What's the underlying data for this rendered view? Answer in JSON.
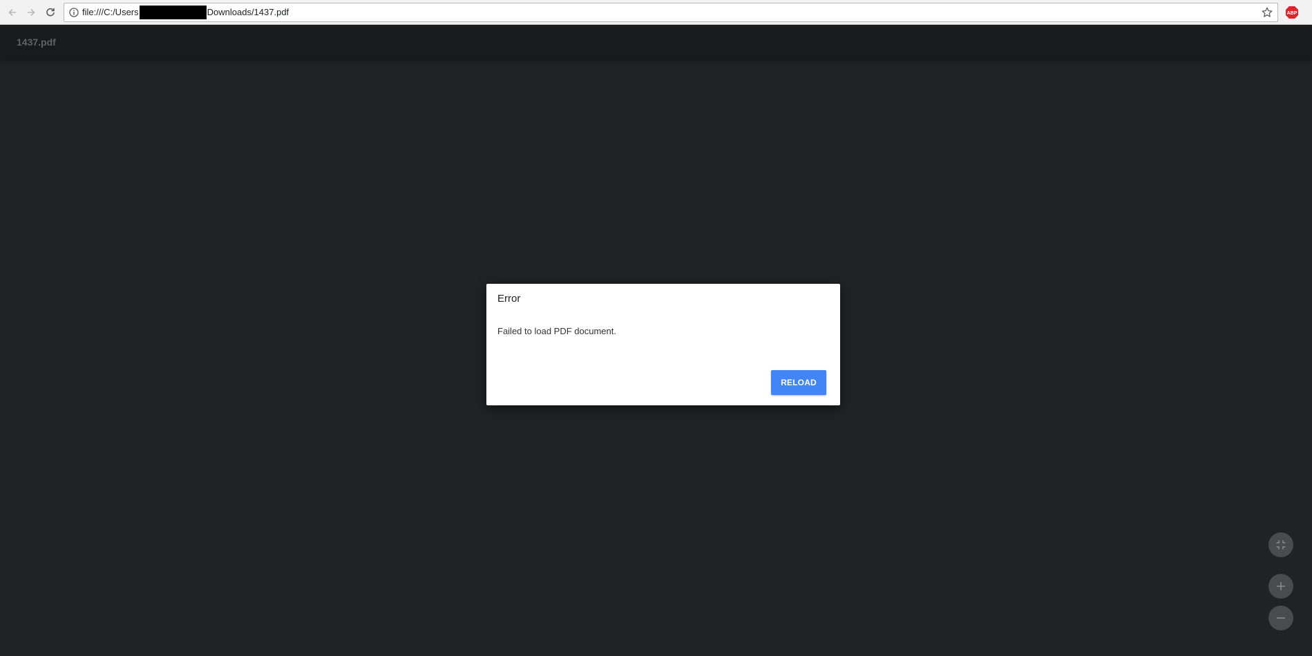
{
  "browser": {
    "url_prefix": "file:///C:/Users",
    "url_suffix": "Downloads/1437.pdf"
  },
  "pdf_toolbar": {
    "title": "1437.pdf"
  },
  "dialog": {
    "title": "Error",
    "message": "Failed to load PDF document.",
    "reload_label": "RELOAD"
  },
  "colors": {
    "accent": "#4285f4",
    "viewer_background": "#212224"
  }
}
